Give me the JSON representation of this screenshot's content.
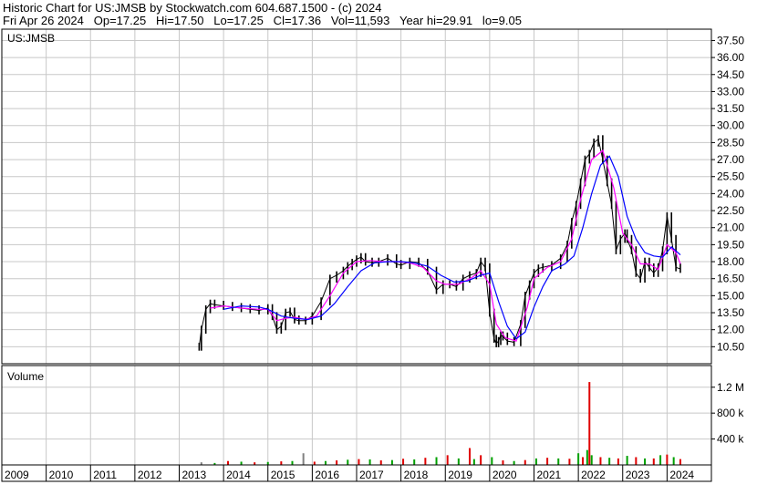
{
  "header": {
    "line1": "Historic Chart for US:JMSB by Stockwatch.com 604.687.1500 - (c) 2024",
    "line2": "Fri Apr 26 2024   Op=17.25   Hi=17.50   Lo=17.25   Cl=17.36   Vol=11,593   Year hi=29.91   lo=9.05"
  },
  "colors": {
    "background": "#ffffff",
    "grid": "#c8c8c8",
    "price_bars": "#000000",
    "ma_short": "#ff00ff",
    "ma_long": "#0000ff",
    "vol_up": "#00a000",
    "vol_down": "#e00000",
    "vol_flat": "#808080"
  },
  "chart_data": [
    {
      "type": "line",
      "symbol_label": "US:JMSB",
      "x_kind": "year",
      "ylim": [
        9,
        38.5
      ],
      "yticks": [
        "37.50",
        "36.00",
        "34.50",
        "33.00",
        "31.50",
        "30.00",
        "28.50",
        "27.00",
        "25.50",
        "24.00",
        "22.50",
        "21.00",
        "19.50",
        "18.00",
        "16.50",
        "15.00",
        "13.50",
        "12.00",
        "10.50"
      ],
      "grid": true,
      "series": [
        {
          "kind": "price",
          "x": [
            2013.45,
            2013.5,
            2013.6,
            2013.7,
            2013.8,
            2014.0,
            2014.2,
            2014.4,
            2014.6,
            2014.8,
            2015.0,
            2015.1,
            2015.2,
            2015.3,
            2015.4,
            2015.5,
            2015.6,
            2015.7,
            2015.85,
            2016.0,
            2016.2,
            2016.4,
            2016.55,
            2016.7,
            2016.8,
            2016.9,
            2017.0,
            2017.1,
            2017.2,
            2017.35,
            2017.5,
            2017.7,
            2017.9,
            2018.0,
            2018.2,
            2018.4,
            2018.6,
            2018.8,
            2018.95,
            2019.1,
            2019.25,
            2019.4,
            2019.55,
            2019.7,
            2019.8,
            2019.9,
            2020.0,
            2020.1,
            2020.15,
            2020.2,
            2020.25,
            2020.3,
            2020.4,
            2020.55,
            2020.7,
            2020.8,
            2020.9,
            2021.0,
            2021.1,
            2021.2,
            2021.4,
            2021.6,
            2021.75,
            2021.85,
            2021.95,
            2022.05,
            2022.15,
            2022.25,
            2022.35,
            2022.45,
            2022.55,
            2022.65,
            2022.75,
            2022.85,
            2022.95,
            2023.05,
            2023.1,
            2023.2,
            2023.3,
            2023.4,
            2023.5,
            2023.6,
            2023.7,
            2023.8,
            2023.9,
            2024.0,
            2024.1,
            2024.2,
            2024.3
          ],
          "y": [
            10.5,
            12.0,
            13.8,
            14.3,
            14.2,
            14.1,
            14.0,
            13.9,
            13.8,
            13.7,
            13.9,
            13.2,
            12.0,
            12.3,
            13.5,
            13.6,
            12.9,
            12.8,
            12.8,
            13.2,
            14.5,
            16.5,
            16.8,
            17.2,
            17.6,
            17.9,
            18.2,
            18.4,
            18.0,
            17.9,
            18.0,
            18.3,
            17.8,
            17.7,
            18.0,
            17.9,
            17.2,
            15.5,
            16.0,
            16.0,
            15.8,
            16.5,
            16.8,
            17.0,
            18.0,
            17.5,
            13.5,
            11.2,
            10.8,
            11.0,
            11.5,
            11.4,
            11.0,
            10.9,
            12.5,
            15.0,
            16.0,
            17.0,
            17.4,
            17.5,
            17.7,
            18.3,
            19.5,
            21.5,
            23.0,
            25.0,
            27.0,
            27.5,
            28.5,
            28.8,
            27.0,
            25.0,
            23.0,
            19.0,
            20.0,
            20.5,
            20.0,
            19.0,
            17.0,
            16.5,
            18.0,
            17.5,
            17.0,
            17.5,
            19.0,
            22.0,
            20.0,
            17.5,
            17.36
          ]
        },
        {
          "kind": "ma-short",
          "x": [
            2013.7,
            2014.0,
            2014.4,
            2014.8,
            2015.0,
            2015.2,
            2015.4,
            2015.6,
            2015.85,
            2016.1,
            2016.4,
            2016.7,
            2017.0,
            2017.3,
            2017.6,
            2017.9,
            2018.2,
            2018.5,
            2018.8,
            2019.0,
            2019.3,
            2019.6,
            2019.8,
            2020.0,
            2020.15,
            2020.35,
            2020.6,
            2020.85,
            2021.0,
            2021.3,
            2021.6,
            2021.85,
            2022.05,
            2022.3,
            2022.55,
            2022.8,
            2023.0,
            2023.2,
            2023.4,
            2023.6,
            2023.8,
            2024.0,
            2024.2,
            2024.3
          ],
          "y": [
            13.9,
            14.1,
            13.9,
            13.8,
            13.8,
            12.8,
            13.0,
            13.1,
            12.9,
            13.2,
            15.0,
            17.0,
            18.0,
            18.1,
            18.0,
            18.0,
            17.9,
            17.5,
            16.3,
            16.0,
            16.0,
            16.6,
            17.2,
            16.0,
            12.5,
            11.3,
            11.0,
            14.0,
            16.5,
            17.5,
            18.0,
            20.0,
            23.5,
            27.0,
            27.8,
            24.5,
            20.5,
            19.5,
            17.8,
            17.8,
            17.3,
            19.5,
            18.8,
            17.8
          ]
        },
        {
          "kind": "ma-long",
          "x": [
            2014.0,
            2014.4,
            2014.8,
            2015.0,
            2015.3,
            2015.6,
            2015.9,
            2016.2,
            2016.5,
            2016.8,
            2017.1,
            2017.4,
            2017.7,
            2018.0,
            2018.3,
            2018.6,
            2018.9,
            2019.2,
            2019.5,
            2019.8,
            2020.0,
            2020.2,
            2020.4,
            2020.6,
            2020.8,
            2021.0,
            2021.2,
            2021.4,
            2021.7,
            2021.9,
            2022.1,
            2022.3,
            2022.5,
            2022.7,
            2022.9,
            2023.1,
            2023.3,
            2023.5,
            2023.7,
            2023.9,
            2024.1,
            2024.3
          ],
          "y": [
            13.8,
            14.1,
            14.0,
            13.8,
            13.2,
            13.0,
            12.9,
            13.2,
            14.3,
            15.8,
            17.2,
            17.9,
            18.0,
            18.0,
            17.9,
            17.6,
            16.8,
            16.2,
            16.3,
            16.8,
            17.0,
            14.5,
            12.3,
            11.2,
            11.8,
            14.0,
            15.8,
            17.2,
            17.8,
            18.5,
            21.0,
            24.0,
            26.5,
            27.3,
            25.5,
            22.0,
            20.0,
            18.8,
            18.5,
            18.4,
            19.3,
            18.6
          ]
        }
      ]
    },
    {
      "type": "bar",
      "name": "Volume",
      "ylim": [
        0,
        1450000
      ],
      "yticks": [
        "1.2 M",
        "800 k",
        "400 k"
      ],
      "ytick_values": [
        1200000,
        800000,
        400000
      ],
      "x": [
        2013.5,
        2013.8,
        2014.1,
        2014.4,
        2014.7,
        2015.0,
        2015.3,
        2015.55,
        2015.8,
        2016.05,
        2016.3,
        2016.55,
        2016.8,
        2017.05,
        2017.3,
        2017.55,
        2017.8,
        2018.05,
        2018.3,
        2018.55,
        2018.8,
        2019.05,
        2019.3,
        2019.55,
        2019.65,
        2019.8,
        2020.05,
        2020.3,
        2020.55,
        2020.8,
        2021.05,
        2021.3,
        2021.55,
        2021.8,
        2022.0,
        2022.1,
        2022.2,
        2022.25,
        2022.3,
        2022.5,
        2022.7,
        2022.9,
        2023.1,
        2023.3,
        2023.5,
        2023.7,
        2023.85,
        2024.0,
        2024.15,
        2024.3
      ],
      "values": [
        40000,
        30000,
        60000,
        50000,
        40000,
        45000,
        55000,
        60000,
        180000,
        50000,
        60000,
        70000,
        80000,
        90000,
        85000,
        70000,
        75000,
        95000,
        85000,
        110000,
        120000,
        150000,
        100000,
        260000,
        90000,
        150000,
        120000,
        70000,
        60000,
        75000,
        100000,
        110000,
        100000,
        95000,
        180000,
        120000,
        230000,
        1280000,
        150000,
        120000,
        110000,
        100000,
        140000,
        120000,
        100000,
        100000,
        150000,
        160000,
        120000,
        90000
      ],
      "direction": [
        "flat",
        "up",
        "down",
        "up",
        "down",
        "up",
        "down",
        "up",
        "flat",
        "down",
        "up",
        "down",
        "up",
        "down",
        "up",
        "down",
        "up",
        "down",
        "up",
        "down",
        "up",
        "down",
        "up",
        "down",
        "up",
        "down",
        "up",
        "down",
        "up",
        "down",
        "up",
        "down",
        "up",
        "down",
        "up",
        "down",
        "up",
        "down",
        "up",
        "down",
        "up",
        "down",
        "up",
        "down",
        "up",
        "down",
        "up",
        "down",
        "up",
        "down"
      ]
    }
  ],
  "x_axis": {
    "year_labels": [
      "2009",
      "2010",
      "2011",
      "2012",
      "2013",
      "2014",
      "2015",
      "2016",
      "2017",
      "2018",
      "2019",
      "2020",
      "2021",
      "2022",
      "2023",
      "2024"
    ]
  },
  "volume_panel": {
    "title": "Volume"
  }
}
